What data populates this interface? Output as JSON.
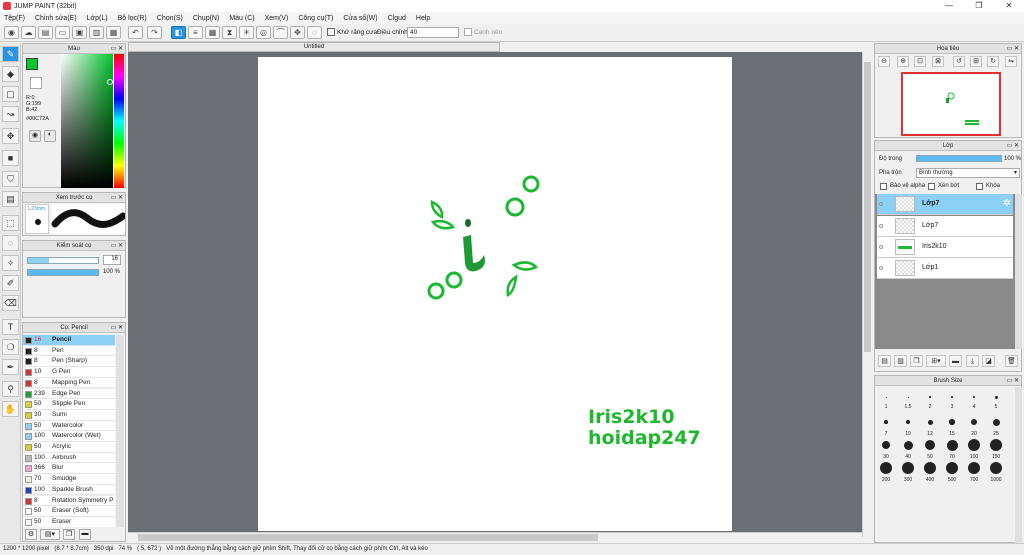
{
  "window": {
    "title": "JUMP PAINT (32bit)",
    "min": "—",
    "max": "❐",
    "close": "✕"
  },
  "menu": [
    "Tệp(F)",
    "Chỉnh sửa(E)",
    "Lớp(L)",
    "Bộ lọc(R)",
    "Chọn(S)",
    "Chụp(N)",
    "Màu (C)",
    "Xem(V)",
    "Công cụ(T)",
    "Cửa sổ(W)",
    "Clgud",
    "Help"
  ],
  "toolbar": {
    "antialias_label": "Khử răng cưa",
    "adjust_label": "Điều chỉnh",
    "adjust_value": "40",
    "canh_label": "Cạnh nền"
  },
  "doc": {
    "tab": "Untitled"
  },
  "color_panel": {
    "title": "Màu",
    "r": "R:0",
    "g": "G:199",
    "b": "B:42",
    "hex": "#00C72A",
    "color": "#00C72A"
  },
  "preview_panel": {
    "title": "Xem trước cọ",
    "size": "1.23mm"
  },
  "brush_control": {
    "title": "Kiểm soát cọ",
    "size": "16",
    "opacity": "100 %"
  },
  "brush_list": {
    "title": "Cọ: Pencil",
    "items": [
      {
        "size": "16",
        "name": "Pencil",
        "color": "#222222",
        "sel": true
      },
      {
        "size": "8",
        "name": "Pen",
        "color": "#222222"
      },
      {
        "size": "8",
        "name": "Pen (Sharp)",
        "color": "#222222"
      },
      {
        "size": "10",
        "name": "G Pen",
        "color": "#d93030"
      },
      {
        "size": "8",
        "name": "Mapping Pen",
        "color": "#d93030"
      },
      {
        "size": "239",
        "name": "Edge Pen",
        "color": "#19a82c"
      },
      {
        "size": "50",
        "name": "Stipple Pen",
        "color": "#e0d020"
      },
      {
        "size": "30",
        "name": "Sumi",
        "color": "#e0d020"
      },
      {
        "size": "50",
        "name": "Watercolor",
        "color": "#88d4f0"
      },
      {
        "size": "100",
        "name": "Watercolor (Wet)",
        "color": "#88d4f0"
      },
      {
        "size": "50",
        "name": "Acrylic",
        "color": "#e0d020"
      },
      {
        "size": "100",
        "name": "Airbrush",
        "color": "#bbbbbb"
      },
      {
        "size": "366",
        "name": "Blur",
        "color": "#f0a0d8"
      },
      {
        "size": "70",
        "name": "Smudge",
        "color": "#f0f0e0"
      },
      {
        "size": "100",
        "name": "Sparkle Brush",
        "color": "#2040c0"
      },
      {
        "size": "8",
        "name": "Rotation Symmetry P",
        "color": "#d93030"
      },
      {
        "size": "50",
        "name": "Eraser (Soft)",
        "color": "#ffffff"
      },
      {
        "size": "50",
        "name": "Eraser",
        "color": "#ffffff"
      }
    ]
  },
  "navigator": {
    "title": "Hoa tiêu"
  },
  "layer_panel": {
    "title": "Lớp",
    "opacity_label": "Độ trong",
    "opacity_value": "100 %",
    "blend_label": "Pha trộn",
    "blend_value": "Bình thường",
    "protect_alpha": "Bảo vệ alpha",
    "clip": "Xén bớt",
    "lock": "Khóa",
    "layers": [
      {
        "name": "Lớp7",
        "sel": true
      },
      {
        "name": "Lớp7"
      },
      {
        "name": "Iris2k10"
      },
      {
        "name": "Lớp1"
      }
    ]
  },
  "brush_size": {
    "title": "Brush Size",
    "sizes": [
      "1",
      "1.5",
      "2",
      "3",
      "4",
      "5",
      "7",
      "10",
      "12",
      "15",
      "20",
      "25",
      "30",
      "40",
      "50",
      "70",
      "100",
      "150",
      "200",
      "300",
      "400",
      "500",
      "700",
      "1000"
    ]
  },
  "canvas_text": {
    "line1": "Iris2k10",
    "line2": "hoidap247"
  },
  "status": {
    "dims": "1200 * 1200 pixel",
    "cm": "(8.7 * 8.7cm)",
    "dpi": "350 dpi",
    "zoom": "74 %",
    "coord": "( 5, 672 )",
    "hint": "Vẽ một đường thẳng bằng cách giữ phím Shift, Thay đổi cỡ cọ bằng cách giữ phím Ctrl, Alt và kéo"
  }
}
